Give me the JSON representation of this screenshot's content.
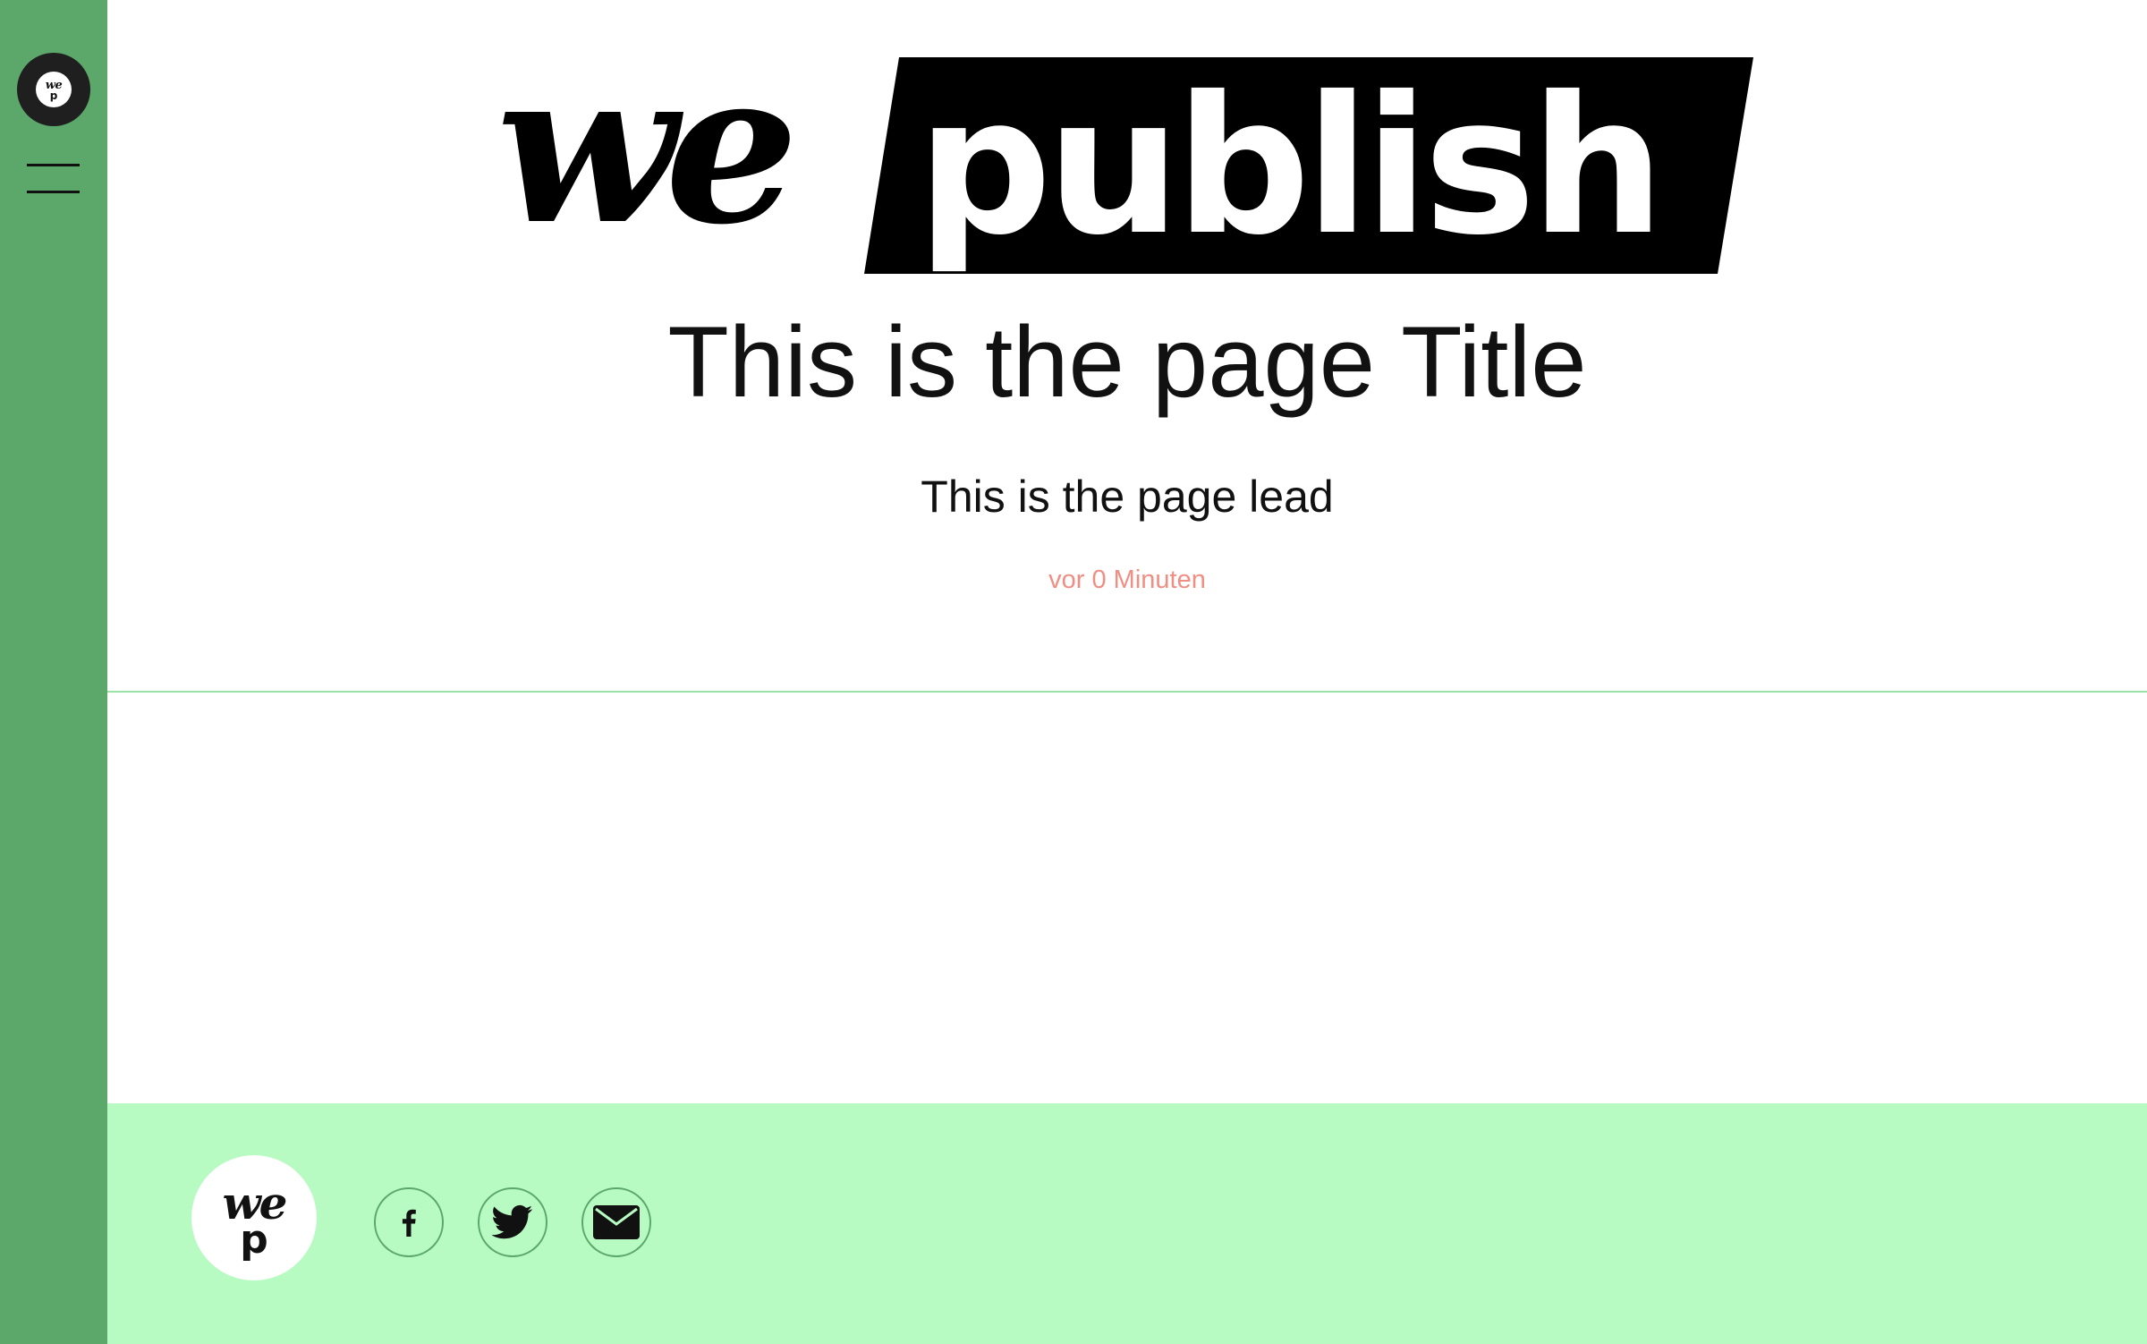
{
  "sidebar": {
    "logo": {
      "alt": "we publish",
      "line1": "we",
      "line2": "p"
    },
    "menu_icon": "hamburger-menu-icon"
  },
  "masthead": {
    "wordmark_left": "we",
    "wordmark_right": "publish"
  },
  "page": {
    "title": "This is the page Title",
    "lead": "This is the page lead",
    "date": "vor 0 Minuten"
  },
  "footer": {
    "logo": {
      "line1": "we",
      "line2": "p"
    },
    "social": [
      {
        "name": "facebook",
        "icon": "facebook-icon"
      },
      {
        "name": "twitter",
        "icon": "twitter-icon"
      },
      {
        "name": "email",
        "icon": "mail-icon"
      }
    ]
  },
  "colors": {
    "sidebar": "#5ca86a",
    "footer": "#b7fbc2",
    "divider": "#9be2a6",
    "date": "#f08e83",
    "text": "#111111"
  }
}
